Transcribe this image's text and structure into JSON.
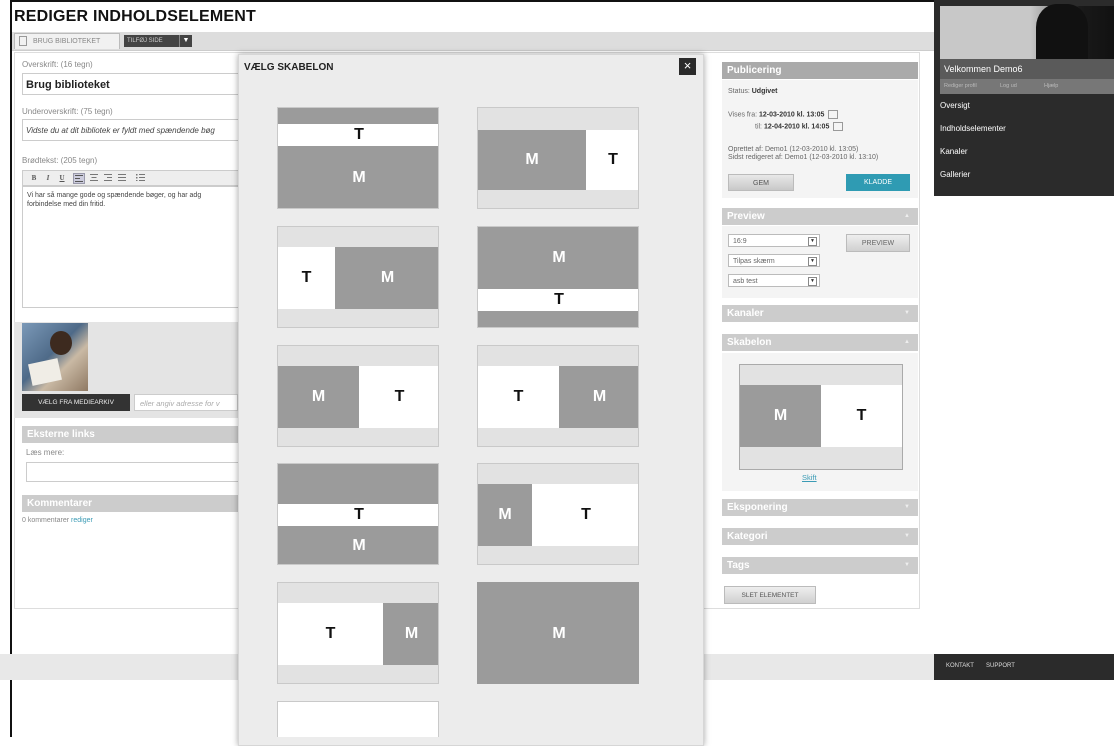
{
  "page_title": "REDIGER INDHOLDSELEMENT",
  "tabs": [
    {
      "label": "BRUG BIBLIOTEKET"
    },
    {
      "label": "TILFØJ SIDE"
    }
  ],
  "form": {
    "headline_label": "Overskrift: (16 tegn)",
    "headline_value": "Brug biblioteket",
    "subheadline_label": "Underoverskrift: (75 tegn)",
    "subheadline_value": "Vidste du at dit bibliotek er fyldt med spændende bøg",
    "body_label": "Brødtekst: (205 tegn)",
    "body_value": "Vi har så mange gode og spændende bøger, og har adg\nforbindelse med din fritid.",
    "toolbar": [
      "B",
      "I",
      "U"
    ],
    "media_button": "VÆLG FRA MEDIEARKIV",
    "media_placeholder": "eller angiv adresse for v"
  },
  "external_links": {
    "title": "Eksterne links",
    "field_label": "Læs mere:"
  },
  "comments": {
    "title": "Kommentarer",
    "count_text": "0 kommentarer",
    "edit_link": "rediger"
  },
  "publishing": {
    "title": "Publicering",
    "status_label": "Status:",
    "status_value": "Udgivet",
    "from_label": "Vises fra:",
    "from_value": "12-03-2010 kl. 13:05",
    "to_label": "til:",
    "to_value": "12-04-2010 kl. 14:05",
    "created": "Oprettet af:  Demo1 (12-03-2010 kl. 13:05)",
    "edited": "Sidst redigeret af:  Demo1 (12-03-2010 kl. 13:10)",
    "save_label": "GEM",
    "draft_label": "KLADDE"
  },
  "preview": {
    "title": "Preview",
    "aspect": "16:9",
    "fit": "Tilpas skærm",
    "device": "asb test",
    "button": "PREVIEW"
  },
  "channels": {
    "title": "Kanaler"
  },
  "template_panel": {
    "title": "Skabelon",
    "change_link": "Skift"
  },
  "exposure": {
    "title": "Eksponering"
  },
  "category": {
    "title": "Kategori"
  },
  "tags": {
    "title": "Tags"
  },
  "delete_button": "SLET ELEMENTET",
  "sidebar": {
    "welcome": "Velkommen Demo6",
    "sub_links": [
      "Rediger profil",
      "Log ud",
      "Hjælp"
    ],
    "items": [
      "Oversigt",
      "Indholdselementer",
      "Kanaler",
      "Gallerier"
    ],
    "footer_links": [
      "KONTAKT",
      "SUPPORT"
    ]
  },
  "modal": {
    "title": "VÆLG SKABELON",
    "close": "×",
    "media_letter": "M",
    "text_letter": "T"
  },
  "colors": {
    "accent": "#2f9bb3",
    "dark": "#2b2b2b",
    "media_block": "#9b9b9b",
    "section_header": "#cccccc"
  }
}
